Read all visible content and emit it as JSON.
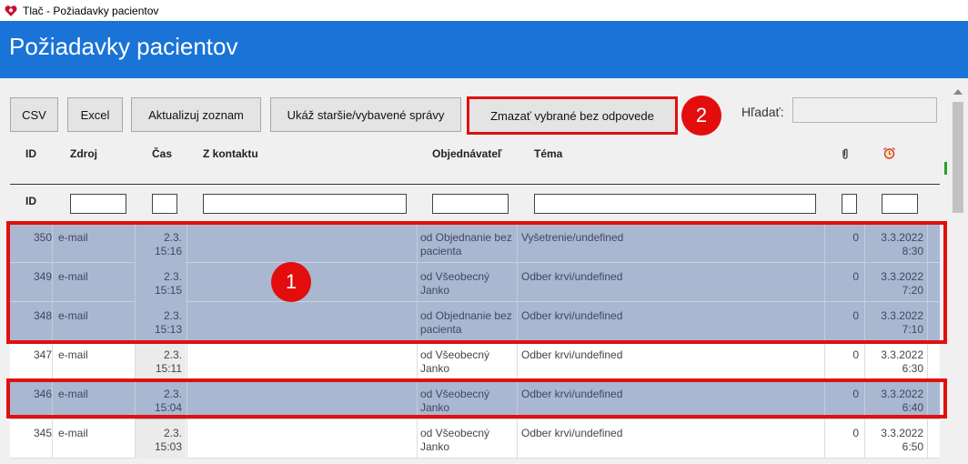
{
  "window": {
    "title": "Tlač - Požiadavky pacientov"
  },
  "header": {
    "title": "Požiadavky pacientov"
  },
  "toolbar": {
    "csv": "CSV",
    "excel": "Excel",
    "refresh": "Aktualizuj zoznam",
    "show_older": "Ukáž staršie/vybavené správy",
    "delete_selected": "Zmazať vybrané bez odpovede"
  },
  "search": {
    "label": "Hľadať:",
    "value": ""
  },
  "badges": {
    "one": "1",
    "two": "2"
  },
  "columns": {
    "id": "ID",
    "source": "Zdroj",
    "time": "Čas",
    "contact": "Z kontaktu",
    "orderer": "Objednávateľ",
    "topic": "Téma",
    "attachment_icon": "paperclip-icon",
    "alarm_icon": "alarm-clock-icon"
  },
  "filter_row": {
    "id_label": "ID"
  },
  "rows": [
    {
      "id": "350",
      "source": "e-mail",
      "time1": "2.3.",
      "time2": "15:16",
      "orderer1": "od Objednanie bez",
      "orderer2": "pacienta",
      "topic": "Vyšetrenie/undefined",
      "count": "0",
      "date1": "3.3.2022",
      "date2": "8:30",
      "selected": true
    },
    {
      "id": "349",
      "source": "e-mail",
      "time1": "2.3.",
      "time2": "15:15",
      "orderer1": "od Všeobecný",
      "orderer2": "Janko",
      "topic": "Odber krvi/undefined",
      "count": "0",
      "date1": "3.3.2022",
      "date2": "7:20",
      "selected": true
    },
    {
      "id": "348",
      "source": "e-mail",
      "time1": "2.3.",
      "time2": "15:13",
      "orderer1": "od Objednanie bez",
      "orderer2": "pacienta",
      "topic": "Odber krvi/undefined",
      "count": "0",
      "date1": "3.3.2022",
      "date2": "7:10",
      "selected": true
    },
    {
      "id": "347",
      "source": "e-mail",
      "time1": "2.3.",
      "time2": "15:11",
      "orderer1": "od Všeobecný",
      "orderer2": "Janko",
      "topic": "Odber krvi/undefined",
      "count": "0",
      "date1": "3.3.2022",
      "date2": "6:30",
      "selected": false
    },
    {
      "id": "346",
      "source": "e-mail",
      "time1": "2.3.",
      "time2": "15:04",
      "orderer1": "od Všeobecný",
      "orderer2": "Janko",
      "topic": "Odber krvi/undefined",
      "count": "0",
      "date1": "3.3.2022",
      "date2": "6:40",
      "selected": true
    },
    {
      "id": "345",
      "source": "e-mail",
      "time1": "2.3.",
      "time2": "15:03",
      "orderer1": "od Všeobecný",
      "orderer2": "Janko",
      "topic": "Odber krvi/undefined",
      "count": "0",
      "date1": "3.3.2022",
      "date2": "6:50",
      "selected": false
    }
  ],
  "colors": {
    "header_blue": "#1a73d6",
    "selection": "#a9b7d1",
    "annotation_red": "#e01010"
  }
}
